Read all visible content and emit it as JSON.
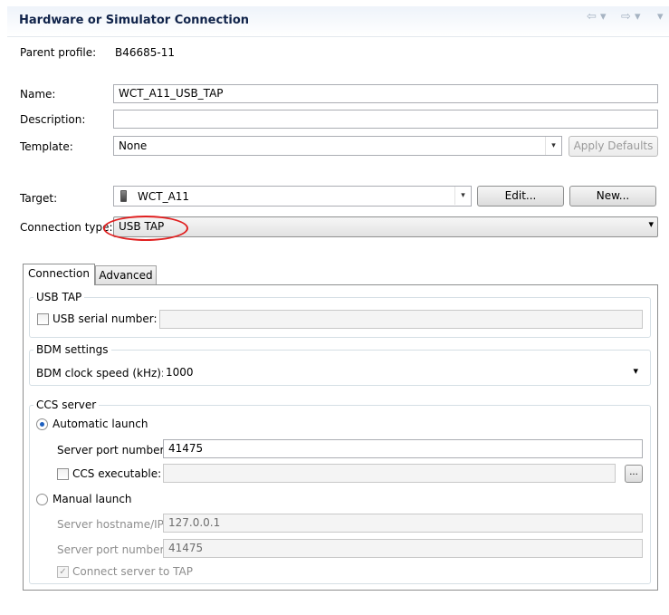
{
  "header": {
    "title": "Hardware or Simulator Connection",
    "nav_back": "⇦ ▾",
    "nav_forward": "⇨ ▾",
    "view_menu": "▾"
  },
  "form": {
    "parent_profile_label": "Parent profile:",
    "parent_profile_value": "B46685-11",
    "name_label": "Name:",
    "name_value": "WCT_A11_USB_TAP",
    "description_label": "Description:",
    "description_value": "",
    "template_label": "Template:",
    "template_value": "None",
    "apply_defaults_label": "Apply Defaults",
    "target_label": "Target:",
    "target_value": "WCT_A11",
    "edit_label": "Edit...",
    "new_label": "New...",
    "connection_type_label": "Connection type:",
    "connection_type_value": "USB TAP"
  },
  "tabs": [
    {
      "label": "Connection",
      "active": true
    },
    {
      "label": "Advanced",
      "active": false
    }
  ],
  "usb_tap": {
    "legend": "USB TAP",
    "serial_label": "USB serial number:",
    "serial_checked": false,
    "serial_value": ""
  },
  "bdm": {
    "legend": "BDM settings",
    "clock_label": "BDM clock speed (kHz):",
    "clock_value": "1000"
  },
  "ccs": {
    "legend": "CCS server",
    "automatic_label": "Automatic launch",
    "automatic_selected": true,
    "server_port_label": "Server port number:",
    "server_port_value": "41475",
    "executable_label": "CCS executable:",
    "executable_checked": false,
    "executable_value": "",
    "browse_label": "...",
    "manual_label": "Manual launch",
    "manual_selected": false,
    "hostname_label": "Server hostname/IP:",
    "hostname_value": "127.0.0.1",
    "manual_port_label": "Server port number:",
    "manual_port_value": "41475",
    "connect_label": "Connect server to TAP",
    "connect_checked": true
  },
  "icons": {
    "combo_arrow": "▾",
    "checkmark": "✓"
  },
  "colors": {
    "header_title": "#10234a",
    "highlight_ellipse": "#e02020",
    "radio_dot": "#1d5fbf"
  }
}
